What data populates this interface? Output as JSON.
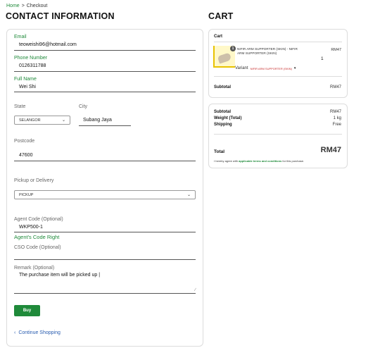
{
  "breadcrumb": {
    "home": "Home",
    "separator": ">",
    "current": "Checkout"
  },
  "contact": {
    "title": "CONTACT INFORMATION",
    "email": {
      "label": "Email",
      "value": "teoweishi96@hotmail.com"
    },
    "phone": {
      "label": "Phone Number",
      "value": "0126311788"
    },
    "full_name": {
      "label": "Full Name",
      "value": "Wei Shi"
    },
    "state": {
      "label": "State",
      "selected": "SELANGOR"
    },
    "city": {
      "label": "City",
      "value": "Subang Jaya"
    },
    "postcode": {
      "label": "Postcode",
      "value": "47600"
    },
    "pickup": {
      "label": "Pickup or Delivery",
      "selected": "PICKUP"
    },
    "agent_code": {
      "label": "Agent Code (Optional)",
      "value": "WKP500-1",
      "status": "Agent's Code Right"
    },
    "cso_code": {
      "label": "CSO Code (Optional)",
      "value": ""
    },
    "remark": {
      "label": "Remark (Optional)",
      "value": "The purchase item will be picked up |"
    },
    "buy_label": "Buy",
    "continue_label": "Continue Shopping"
  },
  "cart": {
    "title": "CART",
    "heading": "Cart",
    "item": {
      "badge": "1",
      "name": "NIFIR ARM SUPPORTER (SKIN) - NIFIR ARM SUPPORTER (SKIN)",
      "price": "RM47",
      "quantity": "1",
      "variant_label": "Variant",
      "variant_value": "NIFIR ARM SUPPORTER (SKIN)"
    },
    "subtotal_label": "Subtotal",
    "subtotal_value": "RM47"
  },
  "summary": {
    "subtotal_label": "Subtotal",
    "subtotal_value": "RM47",
    "weight_label": "Weight (Total)",
    "weight_value": "1 kg",
    "shipping_label": "Shipping",
    "shipping_value": "Free",
    "total_label": "Total",
    "total_value": "RM47",
    "agree_prefix": "I hereby agree with",
    "agree_link": "applicable terms and conditions",
    "agree_suffix": "for this purchase."
  },
  "colors": {
    "accent": "#1f8a3a",
    "link": "#2a5db0",
    "variant": "#c62828"
  },
  "icons": {
    "select": "chevron-down-icon",
    "back": "chevron-left-icon",
    "resize": "resize-handle-icon"
  }
}
